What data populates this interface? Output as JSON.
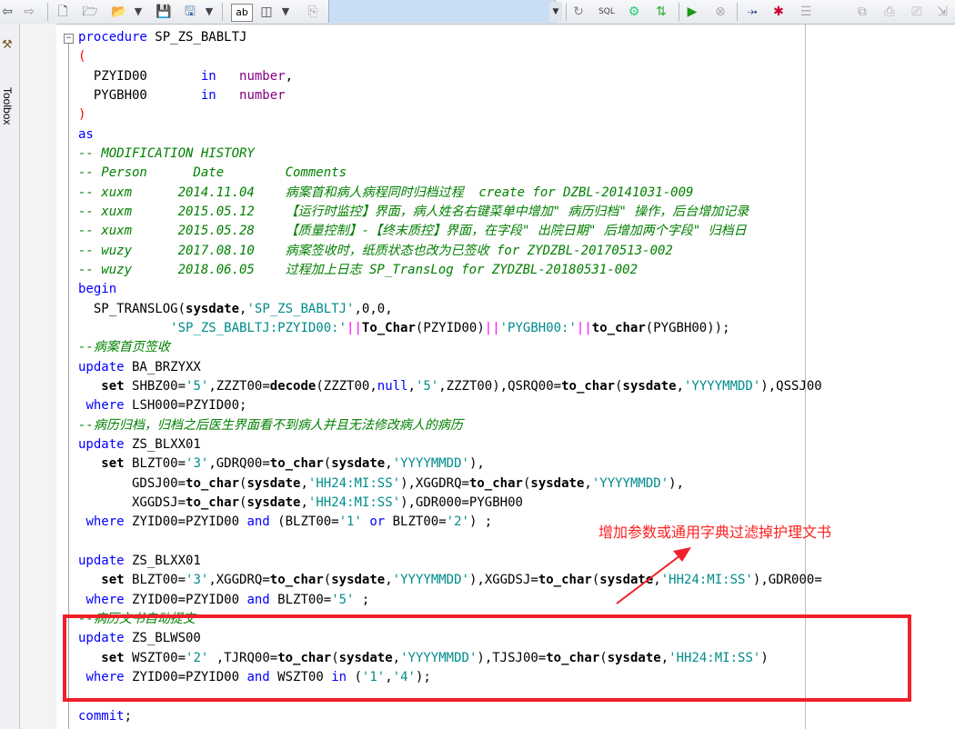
{
  "toolbox": {
    "label": "Toolbox"
  },
  "toolbar": {
    "icons": [
      "back-arrow-icon",
      "forward-arrow-icon",
      "new-file-icon",
      "open-wizard-icon",
      "open-folder-icon",
      "dropdown-icon",
      "save-icon",
      "save-as-icon",
      "dropdown-icon",
      "find-replace-icon",
      "split-view-icon",
      "dropdown-icon",
      "template-icon",
      "refresh-icon",
      "sql-icon",
      "explain-icon",
      "compile-icon",
      "run-icon",
      "stop-icon",
      "step-icon",
      "debug-icon",
      "list-icon",
      "copy-icon",
      "print-icon",
      "print-preview-icon",
      "export-icon"
    ],
    "sql_label": "SQL"
  },
  "code": {
    "lines": [
      {
        "parts": [
          {
            "t": "procedure",
            "c": "kw"
          },
          {
            "t": " SP_ZS_BABLTJ",
            "c": "num"
          }
        ]
      },
      {
        "parts": [
          {
            "t": "(",
            "c": "pa"
          }
        ]
      },
      {
        "parts": [
          {
            "t": "  PZYID00       ",
            "c": "num"
          },
          {
            "t": "in",
            "c": "kw"
          },
          {
            "t": "   ",
            "c": "num"
          },
          {
            "t": "number",
            "c": "pu"
          },
          {
            "t": ",",
            "c": "num"
          }
        ]
      },
      {
        "parts": [
          {
            "t": "  PYGBH00       ",
            "c": "num"
          },
          {
            "t": "in",
            "c": "kw"
          },
          {
            "t": "   ",
            "c": "num"
          },
          {
            "t": "number",
            "c": "pu"
          }
        ]
      },
      {
        "parts": [
          {
            "t": ")",
            "c": "pa"
          }
        ]
      },
      {
        "parts": [
          {
            "t": "as",
            "c": "kw"
          }
        ]
      },
      {
        "parts": [
          {
            "t": "-- MODIFICATION HISTORY",
            "c": "cm"
          }
        ]
      },
      {
        "parts": [
          {
            "t": "-- Person      Date        Comments",
            "c": "cm"
          }
        ]
      },
      {
        "parts": [
          {
            "t": "-- xuxm      2014.11.04    病案首和病人病程同时归档过程  create for DZBL-20141031-009",
            "c": "cm"
          }
        ]
      },
      {
        "parts": [
          {
            "t": "-- xuxm      2015.05.12    【运行时监控】界面，病人姓名右键菜单中增加\" 病历归档\" 操作，后台增加记录",
            "c": "cm"
          }
        ]
      },
      {
        "parts": [
          {
            "t": "-- xuxm      2015.05.28    【质量控制】-【终末质控】界面，在字段\" 出院日期\" 后增加两个字段\" 归档日",
            "c": "cm"
          }
        ]
      },
      {
        "parts": [
          {
            "t": "-- wuzy      2017.08.10    病案签收时，纸质状态也改为已签收 for ZYDZBL-20170513-002",
            "c": "cm"
          }
        ]
      },
      {
        "parts": [
          {
            "t": "-- wuzy      2018.06.05    过程加上日志 SP_TransLog for ZYDZBL-20180531-002",
            "c": "cm"
          }
        ]
      },
      {
        "parts": [
          {
            "t": "begin",
            "c": "kw"
          }
        ]
      },
      {
        "parts": [
          {
            "t": "  SP_TRANSLOG(",
            "c": "num"
          },
          {
            "t": "sysdate",
            "c": "fn"
          },
          {
            "t": ",",
            "c": "num"
          },
          {
            "t": "'SP_ZS_BABLTJ'",
            "c": "str"
          },
          {
            "t": ",0,0,",
            "c": "num"
          }
        ]
      },
      {
        "parts": [
          {
            "t": "            ",
            "c": "num"
          },
          {
            "t": "'SP_ZS_BABLTJ:PZYID00:'",
            "c": "str"
          },
          {
            "t": "||",
            "c": "op"
          },
          {
            "t": "To_Char",
            "c": "fn"
          },
          {
            "t": "(PZYID00)",
            "c": "num"
          },
          {
            "t": "||",
            "c": "op"
          },
          {
            "t": "'PYGBH00:'",
            "c": "str"
          },
          {
            "t": "||",
            "c": "op"
          },
          {
            "t": "to_char",
            "c": "fn"
          },
          {
            "t": "(PYGBH00));",
            "c": "num"
          }
        ]
      },
      {
        "parts": [
          {
            "t": "--病案首页签收",
            "c": "cm"
          }
        ]
      },
      {
        "parts": [
          {
            "t": "update",
            "c": "kw"
          },
          {
            "t": " BA_BRZYXX",
            "c": "num"
          }
        ]
      },
      {
        "parts": [
          {
            "t": "   ",
            "c": "num"
          },
          {
            "t": "set",
            "c": "fn"
          },
          {
            "t": " SHBZ00=",
            "c": "num"
          },
          {
            "t": "'5'",
            "c": "str"
          },
          {
            "t": ",ZZZT00=",
            "c": "num"
          },
          {
            "t": "decode",
            "c": "fn"
          },
          {
            "t": "(ZZZT00,",
            "c": "num"
          },
          {
            "t": "null",
            "c": "kw"
          },
          {
            "t": ",",
            "c": "num"
          },
          {
            "t": "'5'",
            "c": "str"
          },
          {
            "t": ",ZZZT00),QSRQ00=",
            "c": "num"
          },
          {
            "t": "to_char",
            "c": "fn"
          },
          {
            "t": "(",
            "c": "num"
          },
          {
            "t": "sysdate",
            "c": "fn"
          },
          {
            "t": ",",
            "c": "num"
          },
          {
            "t": "'YYYYMMDD'",
            "c": "str"
          },
          {
            "t": "),QSSJ00",
            "c": "num"
          }
        ]
      },
      {
        "parts": [
          {
            "t": " ",
            "c": "num"
          },
          {
            "t": "where",
            "c": "kw"
          },
          {
            "t": " LSH000=PZYID00;",
            "c": "num"
          }
        ]
      },
      {
        "parts": [
          {
            "t": "--病历归档，归档之后医生界面看不到病人并且无法修改病人的病历",
            "c": "cm"
          }
        ]
      },
      {
        "parts": [
          {
            "t": "update",
            "c": "kw"
          },
          {
            "t": " ZS_BLXX01",
            "c": "num"
          }
        ]
      },
      {
        "parts": [
          {
            "t": "   ",
            "c": "num"
          },
          {
            "t": "set",
            "c": "fn"
          },
          {
            "t": " BLZT00=",
            "c": "num"
          },
          {
            "t": "'3'",
            "c": "str"
          },
          {
            "t": ",GDRQ00=",
            "c": "num"
          },
          {
            "t": "to_char",
            "c": "fn"
          },
          {
            "t": "(",
            "c": "num"
          },
          {
            "t": "sysdate",
            "c": "fn"
          },
          {
            "t": ",",
            "c": "num"
          },
          {
            "t": "'YYYYMMDD'",
            "c": "str"
          },
          {
            "t": "),",
            "c": "num"
          }
        ]
      },
      {
        "parts": [
          {
            "t": "       GDSJ00=",
            "c": "num"
          },
          {
            "t": "to_char",
            "c": "fn"
          },
          {
            "t": "(",
            "c": "num"
          },
          {
            "t": "sysdate",
            "c": "fn"
          },
          {
            "t": ",",
            "c": "num"
          },
          {
            "t": "'HH24:MI:SS'",
            "c": "str"
          },
          {
            "t": "),XGGDRQ=",
            "c": "num"
          },
          {
            "t": "to_char",
            "c": "fn"
          },
          {
            "t": "(",
            "c": "num"
          },
          {
            "t": "sysdate",
            "c": "fn"
          },
          {
            "t": ",",
            "c": "num"
          },
          {
            "t": "'YYYYMMDD'",
            "c": "str"
          },
          {
            "t": "),",
            "c": "num"
          }
        ]
      },
      {
        "parts": [
          {
            "t": "       XGGDSJ=",
            "c": "num"
          },
          {
            "t": "to_char",
            "c": "fn"
          },
          {
            "t": "(",
            "c": "num"
          },
          {
            "t": "sysdate",
            "c": "fn"
          },
          {
            "t": ",",
            "c": "num"
          },
          {
            "t": "'HH24:MI:SS'",
            "c": "str"
          },
          {
            "t": "),GDR000=PYGBH00",
            "c": "num"
          }
        ]
      },
      {
        "parts": [
          {
            "t": " ",
            "c": "num"
          },
          {
            "t": "where",
            "c": "kw"
          },
          {
            "t": " ZYID00=PZYID00 ",
            "c": "num"
          },
          {
            "t": "and",
            "c": "kw"
          },
          {
            "t": " (BLZT00=",
            "c": "num"
          },
          {
            "t": "'1'",
            "c": "str"
          },
          {
            "t": " ",
            "c": "num"
          },
          {
            "t": "or",
            "c": "kw"
          },
          {
            "t": " BLZT00=",
            "c": "num"
          },
          {
            "t": "'2'",
            "c": "str"
          },
          {
            "t": ") ;",
            "c": "num"
          }
        ]
      },
      {
        "parts": [
          {
            "t": "",
            "c": "num"
          }
        ]
      },
      {
        "parts": [
          {
            "t": "update",
            "c": "kw"
          },
          {
            "t": " ZS_BLXX01",
            "c": "num"
          }
        ]
      },
      {
        "parts": [
          {
            "t": "   ",
            "c": "num"
          },
          {
            "t": "set",
            "c": "fn"
          },
          {
            "t": " BLZT00=",
            "c": "num"
          },
          {
            "t": "'3'",
            "c": "str"
          },
          {
            "t": ",XGGDRQ=",
            "c": "num"
          },
          {
            "t": "to_char",
            "c": "fn"
          },
          {
            "t": "(",
            "c": "num"
          },
          {
            "t": "sysdate",
            "c": "fn"
          },
          {
            "t": ",",
            "c": "num"
          },
          {
            "t": "'YYYYMMDD'",
            "c": "str"
          },
          {
            "t": "),XGGDSJ=",
            "c": "num"
          },
          {
            "t": "to_char",
            "c": "fn"
          },
          {
            "t": "(",
            "c": "num"
          },
          {
            "t": "sysdate",
            "c": "fn"
          },
          {
            "t": ",",
            "c": "num"
          },
          {
            "t": "'HH24:MI:SS'",
            "c": "str"
          },
          {
            "t": "),GDR000=",
            "c": "num"
          }
        ]
      },
      {
        "parts": [
          {
            "t": " ",
            "c": "num"
          },
          {
            "t": "where",
            "c": "kw"
          },
          {
            "t": " ZYID00=PZYID00 ",
            "c": "num"
          },
          {
            "t": "and",
            "c": "kw"
          },
          {
            "t": " BLZT00=",
            "c": "num"
          },
          {
            "t": "'5'",
            "c": "str"
          },
          {
            "t": " ;",
            "c": "num"
          }
        ]
      },
      {
        "parts": [
          {
            "t": "--病历文书自动提交",
            "c": "cm"
          }
        ]
      },
      {
        "parts": [
          {
            "t": "update",
            "c": "kw"
          },
          {
            "t": " ZS_BLWS00",
            "c": "num"
          }
        ]
      },
      {
        "parts": [
          {
            "t": "   ",
            "c": "num"
          },
          {
            "t": "set",
            "c": "fn"
          },
          {
            "t": " WSZT00=",
            "c": "num"
          },
          {
            "t": "'2'",
            "c": "str"
          },
          {
            "t": " ,TJRQ00=",
            "c": "num"
          },
          {
            "t": "to_char",
            "c": "fn"
          },
          {
            "t": "(",
            "c": "num"
          },
          {
            "t": "sysdate",
            "c": "fn"
          },
          {
            "t": ",",
            "c": "num"
          },
          {
            "t": "'YYYYMMDD'",
            "c": "str"
          },
          {
            "t": "),TJSJ00=",
            "c": "num"
          },
          {
            "t": "to_char",
            "c": "fn"
          },
          {
            "t": "(",
            "c": "num"
          },
          {
            "t": "sysdate",
            "c": "fn"
          },
          {
            "t": ",",
            "c": "num"
          },
          {
            "t": "'HH24:MI:SS'",
            "c": "str"
          },
          {
            "t": ")",
            "c": "num"
          }
        ]
      },
      {
        "parts": [
          {
            "t": " ",
            "c": "num"
          },
          {
            "t": "where",
            "c": "kw"
          },
          {
            "t": " ZYID00=PZYID00 ",
            "c": "num"
          },
          {
            "t": "and",
            "c": "kw"
          },
          {
            "t": " WSZT00 ",
            "c": "num"
          },
          {
            "t": "in",
            "c": "kw"
          },
          {
            "t": " (",
            "c": "num"
          },
          {
            "t": "'1'",
            "c": "str"
          },
          {
            "t": ",",
            "c": "num"
          },
          {
            "t": "'4'",
            "c": "str"
          },
          {
            "t": ");",
            "c": "num"
          }
        ]
      },
      {
        "parts": [
          {
            "t": "",
            "c": "num"
          }
        ]
      },
      {
        "parts": [
          {
            "t": "commit",
            "c": "kw"
          },
          {
            "t": ";",
            "c": "num"
          }
        ]
      }
    ]
  },
  "annotation": {
    "text": "增加参数或通用字典过滤掉护理文书",
    "color": "#ff2020"
  }
}
